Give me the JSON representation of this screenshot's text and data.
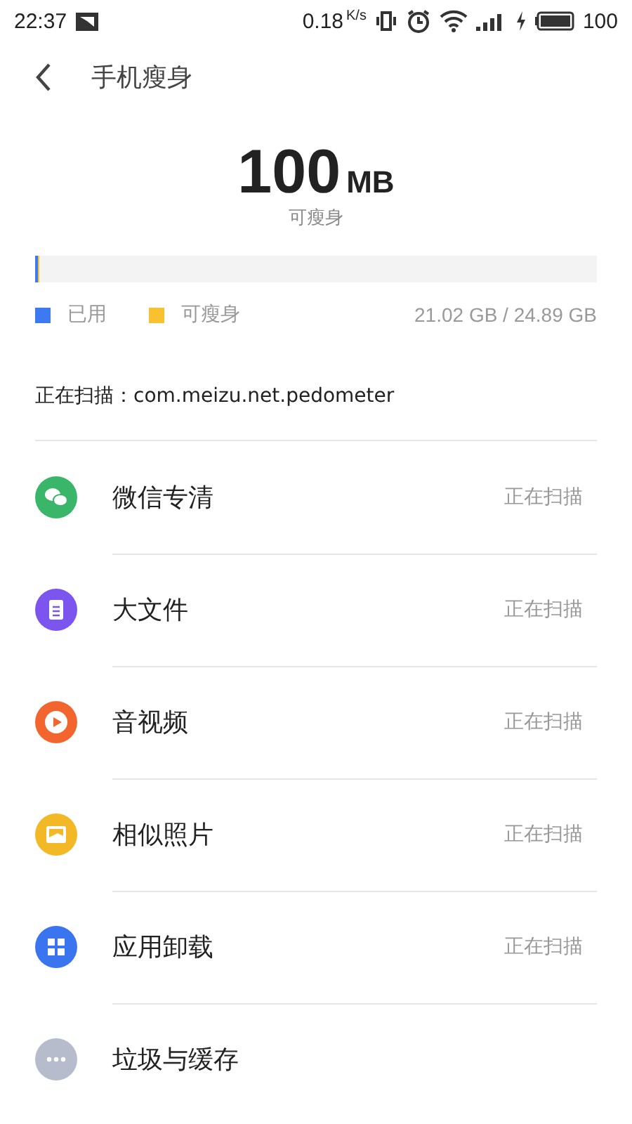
{
  "status_bar": {
    "time": "22:37",
    "speed": "0.18",
    "speed_unit": "K/s",
    "battery": "100"
  },
  "header": {
    "title": "手机瘦身"
  },
  "summary": {
    "amount": "100",
    "unit": "MB",
    "caption": "可瘦身"
  },
  "storage": {
    "segments": [
      {
        "label": "已用",
        "color": "#3d7af0",
        "level": 0.004
      },
      {
        "label": "可瘦身",
        "color": "#f8c130",
        "level": 0.003
      }
    ],
    "reading": "21.02 GB / 24.89 GB"
  },
  "scanning": "正在扫描：com.meizu.net.pedometer",
  "categories": [
    {
      "kind": "chat",
      "label": "微信专清",
      "color": "#3ab66a",
      "status": "正在扫描"
    },
    {
      "kind": "file",
      "label": "大文件",
      "color": "#7c55ee",
      "status": "正在扫描"
    },
    {
      "kind": "video",
      "label": "音视频",
      "color": "#f2652e",
      "status": "正在扫描"
    },
    {
      "kind": "photo",
      "label": "相似照片",
      "color": "#f3b825",
      "status": "正在扫描"
    },
    {
      "kind": "apps",
      "label": "应用卸载",
      "color": "#3a74ee",
      "status": "正在扫描"
    },
    {
      "kind": "more",
      "label": "垃圾与缓存",
      "color": "#b6bccb"
    }
  ]
}
